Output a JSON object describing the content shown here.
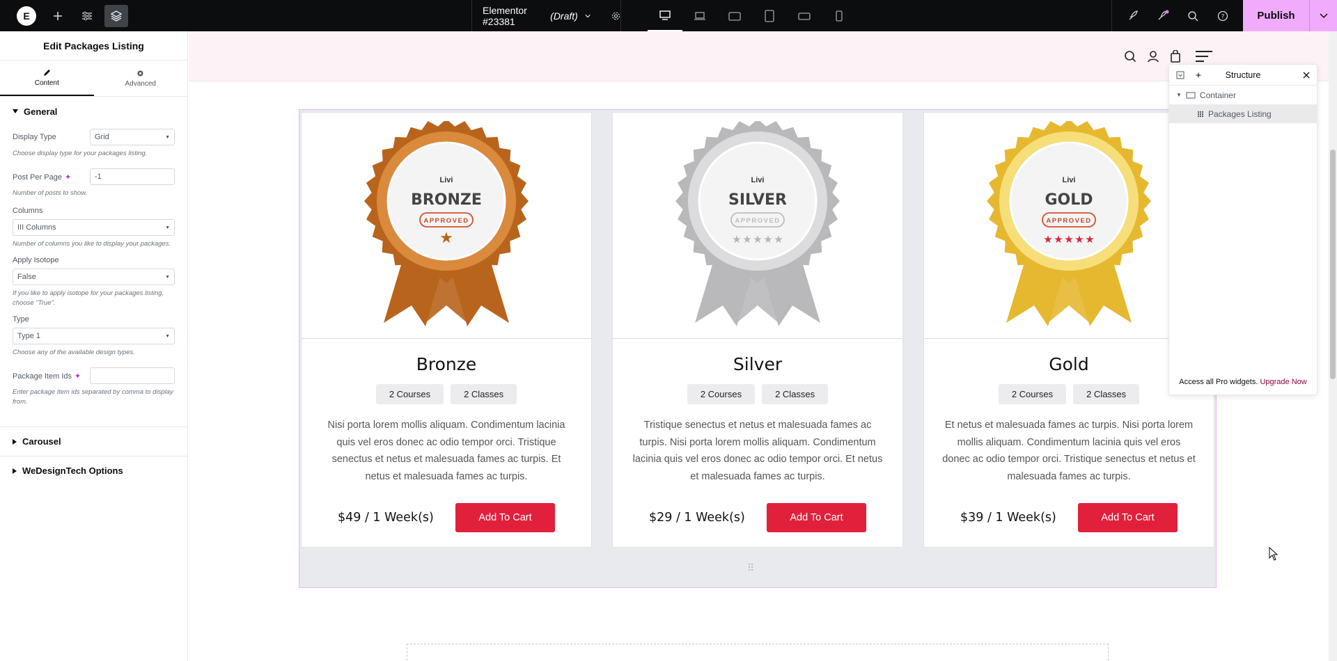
{
  "topbar": {
    "doc_title": "Elementor #23381",
    "doc_status": "(Draft)",
    "publish_label": "Publish"
  },
  "panel": {
    "title": "Edit Packages Listing",
    "tabs": [
      {
        "label": "Content"
      },
      {
        "label": "Advanced"
      }
    ],
    "general_title": "General",
    "display_type": {
      "label": "Display Type",
      "value": "Grid",
      "desc": "Choose display type for your packages listing."
    },
    "post_per_page": {
      "label": "Post Per Page",
      "value": "-1",
      "desc": "Number of posts to show."
    },
    "columns": {
      "label": "Columns",
      "value": "III Columns",
      "desc": "Number of columns you like to display your packages."
    },
    "apply_isotope": {
      "label": "Apply Isotope",
      "value": "False",
      "desc": "If you like to apply isotope for your packages listing, choose \"True\"."
    },
    "type": {
      "label": "Type",
      "value": "Type 1",
      "desc": "Choose any of the available design types."
    },
    "package_item_ids": {
      "label": "Package Item Ids",
      "value": "",
      "desc": "Enter package item ids separated by comma to display from."
    },
    "carousel_title": "Carousel",
    "wedesign_title": "WeDesignTech Options"
  },
  "cards": [
    {
      "name": "Bronze",
      "badge_text": "BRONZE",
      "brand": "Livi",
      "approved": "APPROVED",
      "courses": "2 Courses",
      "classes": "2 Classes",
      "desc": "Nisi porta lorem mollis aliquam. Condimentum lacinia quis vel eros donec ac odio tempor orci. Tristique senectus et netus et malesuada fames ac turpis. Et netus et malesuada fames ac turpis.",
      "price": "$49 / 1 Week(s)",
      "button": "Add To Cart",
      "color": "#b8641c",
      "light": "#d98a3c"
    },
    {
      "name": "Silver",
      "badge_text": "SILVER",
      "brand": "Livi",
      "approved": "APPROVED",
      "courses": "2 Courses",
      "classes": "2 Classes",
      "desc": "Tristique senectus et netus et malesuada fames ac turpis. Nisi porta lorem mollis aliquam. Condimentum lacinia quis vel eros donec ac odio tempor orci. Et netus et malesuada fames ac turpis.",
      "price": "$29 / 1 Week(s)",
      "button": "Add To Cart",
      "color": "#b9b9bb",
      "light": "#dcdcde"
    },
    {
      "name": "Gold",
      "badge_text": "GOLD",
      "brand": "Livi",
      "approved": "APPROVED",
      "courses": "2 Courses",
      "classes": "2 Classes",
      "desc": "Et netus et malesuada fames ac turpis. Nisi porta lorem mollis aliquam. Condimentum lacinia quis vel eros donec ac odio tempor orci. Tristique senectus et netus et malesuada fames ac turpis.",
      "price": "$39 / 1 Week(s)",
      "button": "Add To Cart",
      "color": "#e6b830",
      "light": "#f6de7a"
    }
  ],
  "structure": {
    "title": "Structure",
    "items": [
      {
        "label": "Container"
      },
      {
        "label": "Packages Listing"
      }
    ],
    "footer_text": "Access all Pro widgets.",
    "footer_link": "Upgrade Now"
  },
  "colors": {
    "accent": "#e1203c",
    "publish": "#f0abfc",
    "header_bg": "#fdf2f5"
  }
}
